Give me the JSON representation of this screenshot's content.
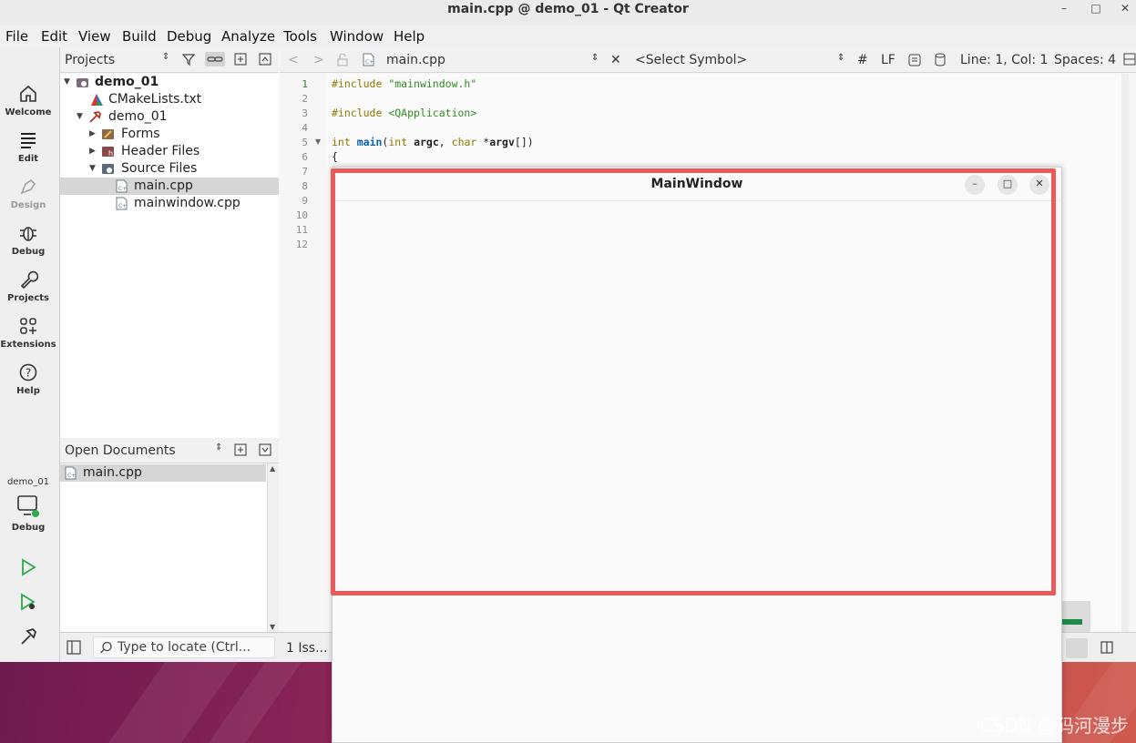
{
  "window": {
    "title": "main.cpp @ demo_01 - Qt Creator"
  },
  "menu": [
    "File",
    "Edit",
    "View",
    "Build",
    "Debug",
    "Analyze",
    "Tools",
    "Window",
    "Help"
  ],
  "modes": {
    "welcome": "Welcome",
    "edit": "Edit",
    "design": "Design",
    "debug": "Debug",
    "projects": "Projects",
    "extensions": "Extensions",
    "help": "Help"
  },
  "kit": {
    "project": "demo_01",
    "config": "Debug"
  },
  "projects_pane": {
    "title": "Projects",
    "tree": {
      "root": "demo_01",
      "cmake": "CMakeLists.txt",
      "target": "demo_01",
      "forms": "Forms",
      "headers": "Header Files",
      "sources": "Source Files",
      "file1": "main.cpp",
      "file2": "mainwindow.cpp"
    }
  },
  "open_docs": {
    "title": "Open Documents",
    "items": [
      "main.cpp"
    ]
  },
  "editor_toolbar": {
    "file": "main.cpp",
    "symbol": "<Select Symbol>",
    "hash": "#",
    "line_ending": "LF",
    "position": "Line: 1, Col: 1",
    "indent": "Spaces: 4"
  },
  "code": {
    "line_numbers": [
      "1",
      "2",
      "3",
      "4",
      "5",
      "6",
      "7",
      "8",
      "9",
      "10",
      "11",
      "12"
    ],
    "l1_kw": "#include",
    "l1_str": "\"mainwindow.h\"",
    "l3_kw": "#include",
    "l3_str": "<QApplication>",
    "l5_int": "int",
    "l5_main": "main",
    "l5_open": "(",
    "l5_int2": "int",
    "l5_argc": "argc",
    "l5_comma": ", ",
    "l5_char": "char",
    "l5_star": " *",
    "l5_argv": "argv",
    "l5_close": "[])",
    "l6": "{"
  },
  "statusbar": {
    "locator_placeholder": "Type to locate (Ctrl...",
    "issues": "1 Iss..."
  },
  "popup": {
    "title": "MainWindow",
    "min": "–",
    "max": "□",
    "close": "✕"
  },
  "watermark": "CSDN @码河漫步",
  "colors": {
    "highlight": "#e95b5b",
    "current_line": "#2e7d32",
    "string": "#2e8b24"
  }
}
